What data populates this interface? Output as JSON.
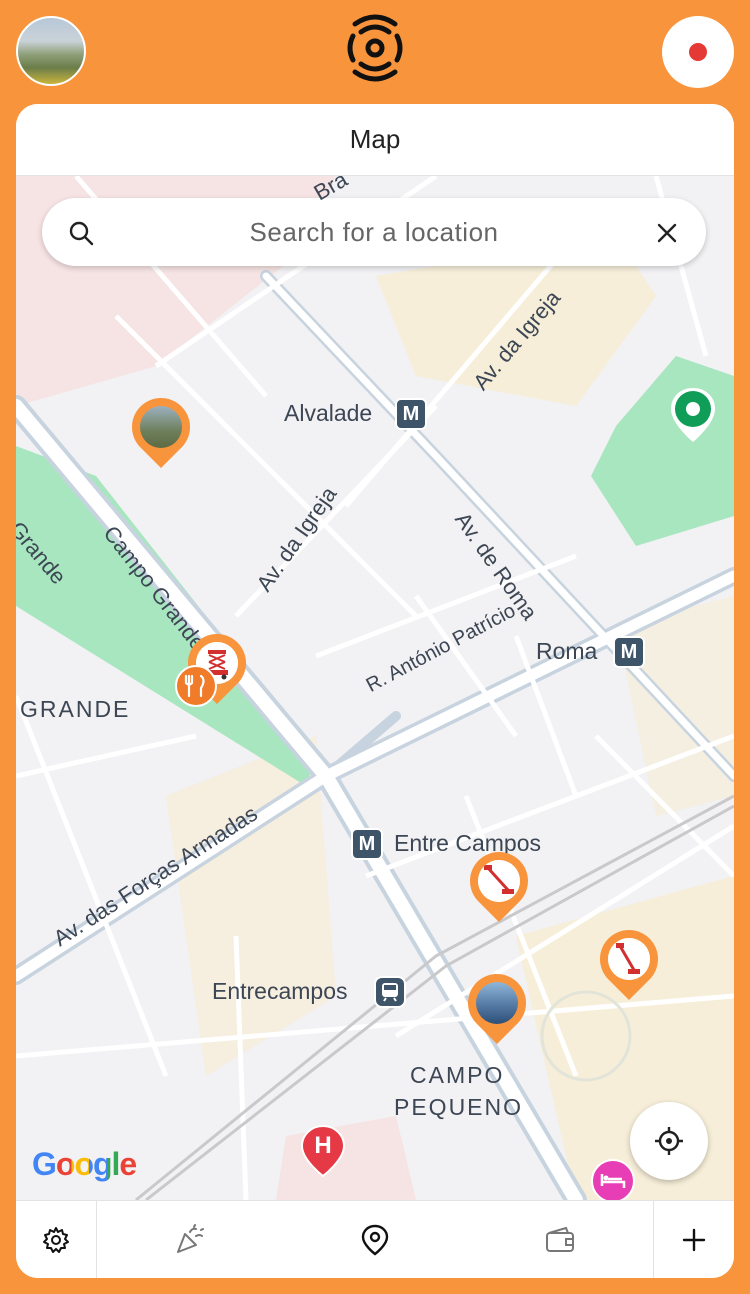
{
  "header": {
    "avatar_icon": "profile-photo-avatar",
    "logo_icon": "broadcast-signal-logo",
    "record_icon": "record-dot-icon",
    "record_color": "#E53935"
  },
  "card": {
    "title": "Map"
  },
  "search": {
    "placeholder": "Search for a location"
  },
  "map": {
    "labels": {
      "alvalade": "Alvalade",
      "roma": "Roma",
      "entre_campos": "Entre Campos",
      "entrecampos": "Entrecampos",
      "campo_grande": "Campo Grande",
      "grande": "GRANDE",
      "campo_pequeno_1": "CAMPO",
      "campo_pequeno_2": "PEQUENO",
      "av_igreja_1": "Av. da Igreja",
      "av_igreja_2": "Av. da Igreja",
      "av_roma": "Av. de Roma",
      "r_antonio": "R. António Patrício",
      "av_forcas": "Av. das Forças Armadas",
      "grande_left": "Grande",
      "bra": "Bra"
    },
    "metro_badge": "M",
    "hospital_badge": "H",
    "attribution": "Google",
    "colors": {
      "accent": "#F8943C",
      "park": "#A8E6C0",
      "metro": "#3E5468"
    }
  },
  "tabbar": {
    "items": [
      {
        "icon": "settings-gear-icon"
      },
      {
        "icon": "party-popper-icon"
      },
      {
        "icon": "map-pin-icon"
      },
      {
        "icon": "wallet-icon"
      },
      {
        "icon": "plus-icon"
      }
    ]
  }
}
